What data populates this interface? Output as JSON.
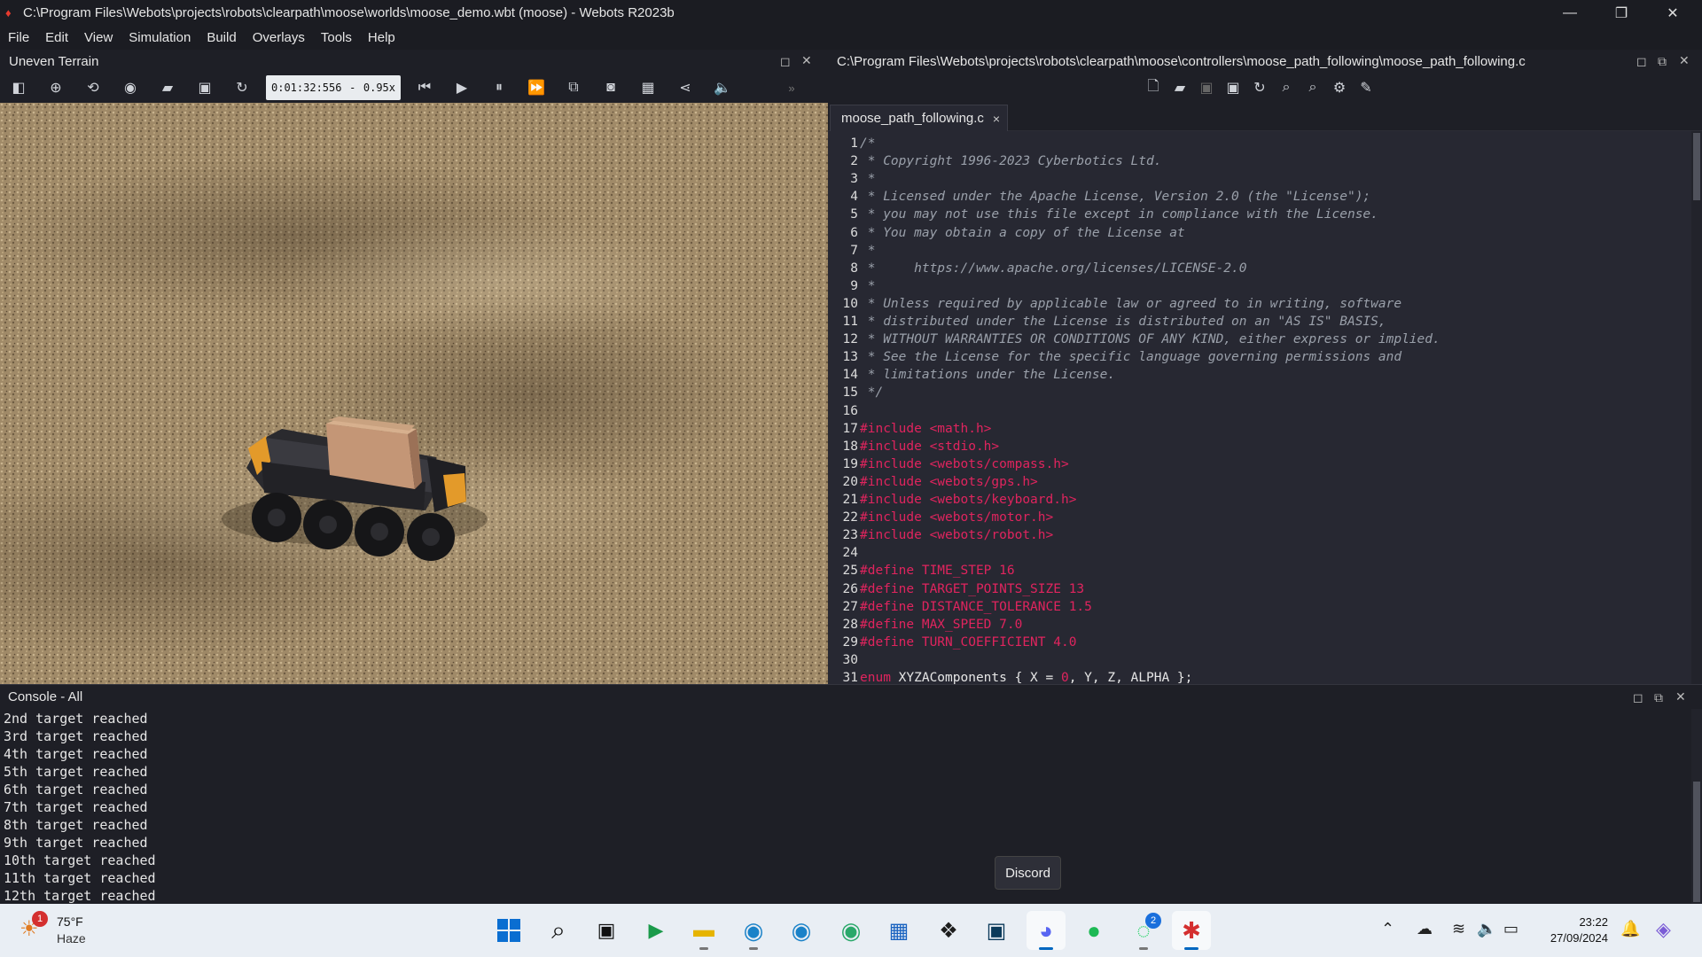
{
  "window": {
    "title": "C:\\Program Files\\Webots\\projects\\robots\\clearpath\\moose\\worlds\\moose_demo.wbt (moose) - Webots R2023b",
    "minimize": "—",
    "maximize": "❐",
    "close": "✕"
  },
  "menu": [
    "File",
    "Edit",
    "View",
    "Simulation",
    "Build",
    "Overlays",
    "Tools",
    "Help"
  ],
  "scene_panel": {
    "title": "Uneven Terrain",
    "time": "0:01:32:556",
    "dash": "-",
    "speed": "0.95x"
  },
  "editor_panel": {
    "path": "C:\\Program Files\\Webots\\projects\\robots\\clearpath\\moose\\controllers\\moose_path_following\\moose_path_following.c",
    "tab": "moose_path_following.c",
    "tab_close": "×",
    "lines": [
      {
        "n": "1",
        "parts": [
          [
            "c-comment",
            "/*"
          ]
        ]
      },
      {
        "n": "2",
        "parts": [
          [
            "c-comment",
            " * Copyright 1996-2023 Cyberbotics Ltd."
          ]
        ]
      },
      {
        "n": "3",
        "parts": [
          [
            "c-comment",
            " *"
          ]
        ]
      },
      {
        "n": "4",
        "parts": [
          [
            "c-comment",
            " * Licensed under the Apache License, Version 2.0 (the \"License\");"
          ]
        ]
      },
      {
        "n": "5",
        "parts": [
          [
            "c-comment",
            " * you may not use this file except in compliance with the License."
          ]
        ]
      },
      {
        "n": "6",
        "parts": [
          [
            "c-comment",
            " * You may obtain a copy of the License at"
          ]
        ]
      },
      {
        "n": "7",
        "parts": [
          [
            "c-comment",
            " *"
          ]
        ]
      },
      {
        "n": "8",
        "parts": [
          [
            "c-comment",
            " *     https://www.apache.org/licenses/LICENSE-2.0"
          ]
        ]
      },
      {
        "n": "9",
        "parts": [
          [
            "c-comment",
            " *"
          ]
        ]
      },
      {
        "n": "10",
        "parts": [
          [
            "c-comment",
            " * Unless required by applicable law or agreed to in writing, software"
          ]
        ]
      },
      {
        "n": "11",
        "parts": [
          [
            "c-comment",
            " * distributed under the License is distributed on an \"AS IS\" BASIS,"
          ]
        ]
      },
      {
        "n": "12",
        "parts": [
          [
            "c-comment",
            " * WITHOUT WARRANTIES OR CONDITIONS OF ANY KIND, either express or implied."
          ]
        ]
      },
      {
        "n": "13",
        "parts": [
          [
            "c-comment",
            " * See the License for the specific language governing permissions and"
          ]
        ]
      },
      {
        "n": "14",
        "parts": [
          [
            "c-comment",
            " * limitations under the License."
          ]
        ]
      },
      {
        "n": "15",
        "parts": [
          [
            "c-comment",
            " */"
          ]
        ]
      },
      {
        "n": "16",
        "parts": []
      },
      {
        "n": "17",
        "parts": [
          [
            "c-pre",
            "#include <math.h>"
          ]
        ]
      },
      {
        "n": "18",
        "parts": [
          [
            "c-pre",
            "#include <stdio.h>"
          ]
        ]
      },
      {
        "n": "19",
        "parts": [
          [
            "c-pre",
            "#include <webots/compass.h>"
          ]
        ]
      },
      {
        "n": "20",
        "parts": [
          [
            "c-pre",
            "#include <webots/gps.h>"
          ]
        ]
      },
      {
        "n": "21",
        "parts": [
          [
            "c-pre",
            "#include <webots/keyboard.h>"
          ]
        ]
      },
      {
        "n": "22",
        "parts": [
          [
            "c-pre",
            "#include <webots/motor.h>"
          ]
        ]
      },
      {
        "n": "23",
        "parts": [
          [
            "c-pre",
            "#include <webots/robot.h>"
          ]
        ]
      },
      {
        "n": "24",
        "parts": []
      },
      {
        "n": "25",
        "parts": [
          [
            "c-pre",
            "#define TIME_STEP 16"
          ]
        ]
      },
      {
        "n": "26",
        "parts": [
          [
            "c-pre",
            "#define TARGET_POINTS_SIZE 13"
          ]
        ]
      },
      {
        "n": "27",
        "parts": [
          [
            "c-pre",
            "#define DISTANCE_TOLERANCE 1.5"
          ]
        ]
      },
      {
        "n": "28",
        "parts": [
          [
            "c-pre",
            "#define MAX_SPEED 7.0"
          ]
        ]
      },
      {
        "n": "29",
        "parts": [
          [
            "c-pre",
            "#define TURN_COEFFICIENT 4.0"
          ]
        ]
      },
      {
        "n": "30",
        "parts": []
      },
      {
        "n": "31",
        "parts": [
          [
            "c-kw",
            "enum"
          ],
          [
            "c-plain",
            " XYZAComponents { X = "
          ],
          [
            "c-num",
            "0"
          ],
          [
            "c-plain",
            ", Y, Z, ALPHA };"
          ]
        ]
      }
    ]
  },
  "console": {
    "title": "Console - All",
    "lines": [
      "2nd target reached",
      "3rd target reached",
      "4th target reached",
      "5th target reached",
      "6th target reached",
      "7th target reached",
      "8th target reached",
      "9th target reached",
      "10th target reached",
      "11th target reached",
      "12th target reached"
    ]
  },
  "tooltip": "Discord",
  "taskbar": {
    "weather": {
      "temp": "75°F",
      "condition": "Haze",
      "badge": "1"
    },
    "whatsapp_badge": "2",
    "time": "23:22",
    "date": "27/09/2024"
  },
  "colors": {
    "accent": "#0067c0",
    "comment": "#9aa0aa",
    "keyword": "#e0245e",
    "panel_bg": "#1e1f26",
    "editor_bg": "#272832"
  }
}
